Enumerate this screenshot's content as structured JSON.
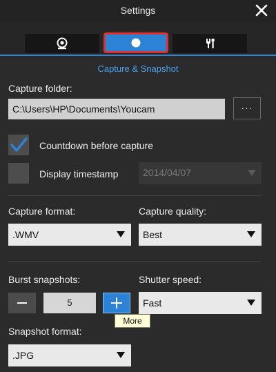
{
  "window": {
    "title": "Settings"
  },
  "tabs": [
    {
      "icon": "webcam-icon"
    },
    {
      "icon": "snapshot-dot-icon",
      "selected": true
    },
    {
      "icon": "tools-icon"
    }
  ],
  "section_title": "Capture & Snapshot",
  "capture_folder": {
    "label": "Capture folder:",
    "value": "C:\\Users\\HP\\Documents\\Youcam",
    "browse_label": "···"
  },
  "countdown": {
    "label": "Countdown before capture",
    "checked": true
  },
  "timestamp": {
    "label": "Display timestamp",
    "checked": false,
    "date_value": "2014/04/07"
  },
  "capture_format": {
    "label": "Capture format:",
    "value": ".WMV"
  },
  "capture_quality": {
    "label": "Capture quality:",
    "value": "Best"
  },
  "burst": {
    "label": "Burst snapshots:",
    "value": "5"
  },
  "shutter_speed": {
    "label": "Shutter speed:",
    "value": "Fast"
  },
  "tooltip": {
    "text": "More"
  },
  "snapshot_format": {
    "label": "Snapshot format:",
    "value": ".JPG"
  },
  "colors": {
    "accent": "#2c83d6",
    "highlight_border": "#e0312f",
    "background": "#2b2b2b"
  }
}
